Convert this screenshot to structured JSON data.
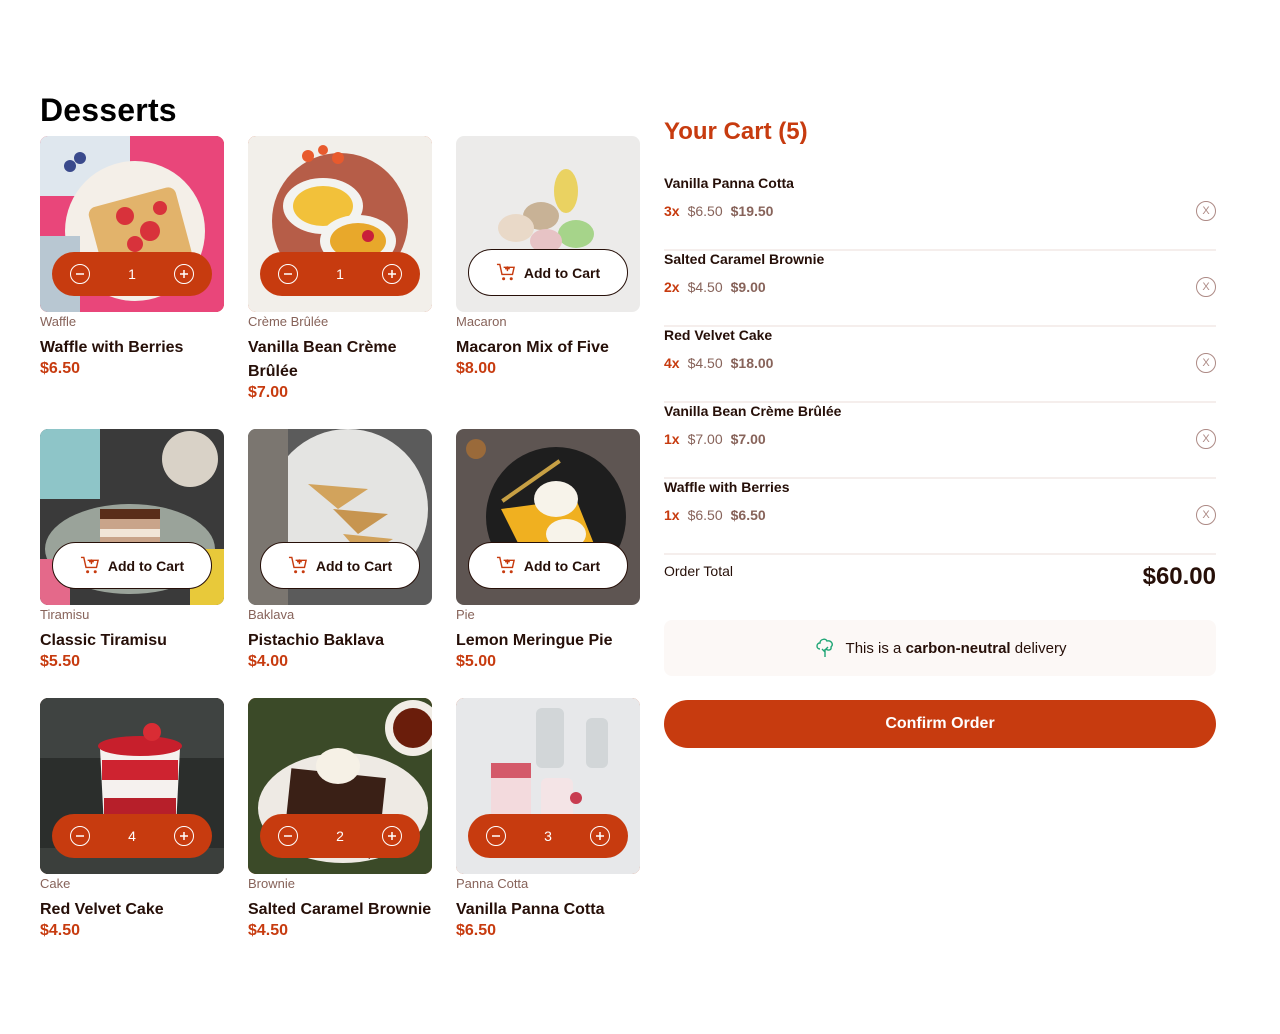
{
  "title": "Desserts",
  "products": [
    {
      "category": "Waffle",
      "name": "Waffle with Berries",
      "price": "$6.50",
      "in_cart": true,
      "quantity": "1"
    },
    {
      "category": "Crème Brûlée",
      "name": "Vanilla Bean Crème Brûlée",
      "price": "$7.00",
      "in_cart": true,
      "quantity": "1"
    },
    {
      "category": "Macaron",
      "name": "Macaron Mix of Five",
      "price": "$8.00",
      "in_cart": false,
      "add_label": "Add to Cart"
    },
    {
      "category": "Tiramisu",
      "name": "Classic Tiramisu",
      "price": "$5.50",
      "in_cart": false,
      "add_label": "Add to Cart"
    },
    {
      "category": "Baklava",
      "name": "Pistachio Baklava",
      "price": "$4.00",
      "in_cart": false,
      "add_label": "Add to Cart"
    },
    {
      "category": "Pie",
      "name": "Lemon Meringue Pie",
      "price": "$5.00",
      "in_cart": false,
      "add_label": "Add to Cart"
    },
    {
      "category": "Cake",
      "name": "Red Velvet Cake",
      "price": "$4.50",
      "in_cart": true,
      "quantity": "4"
    },
    {
      "category": "Brownie",
      "name": "Salted Caramel Brownie",
      "price": "$4.50",
      "in_cart": true,
      "quantity": "2"
    },
    {
      "category": "Panna Cotta",
      "name": "Vanilla Panna Cotta",
      "price": "$6.50",
      "in_cart": true,
      "quantity": "3"
    }
  ],
  "cart": {
    "title": "Your Cart (5)",
    "items": [
      {
        "name": "Vanilla Panna Cotta",
        "qty": "3x",
        "unit": "$6.50",
        "subtotal": "$19.50",
        "remove": "X"
      },
      {
        "name": "Salted Caramel Brownie",
        "qty": "2x",
        "unit": "$4.50",
        "subtotal": "$9.00",
        "remove": "X"
      },
      {
        "name": "Red Velvet Cake",
        "qty": "4x",
        "unit": "$4.50",
        "subtotal": "$18.00",
        "remove": "X"
      },
      {
        "name": "Vanilla Bean Crème Brûlée",
        "qty": "1x",
        "unit": "$7.00",
        "subtotal": "$7.00",
        "remove": "X"
      },
      {
        "name": "Waffle with Berries",
        "qty": "1x",
        "unit": "$6.50",
        "subtotal": "$6.50",
        "remove": "X"
      }
    ],
    "total_label": "Order Total",
    "total_value": "$60.00",
    "carbon_prefix": "This is a",
    "carbon_bold": "carbon-neutral",
    "carbon_suffix": "delivery",
    "confirm_label": "Confirm Order"
  },
  "colors": {
    "accent": "#c73b0f",
    "text": "#260f08",
    "muted": "#87635a",
    "green": "#1ea575"
  },
  "icons": [
    "add-to-cart-icon",
    "decrement-icon",
    "increment-icon",
    "remove-item-icon",
    "carbon-neutral-tree-icon"
  ]
}
